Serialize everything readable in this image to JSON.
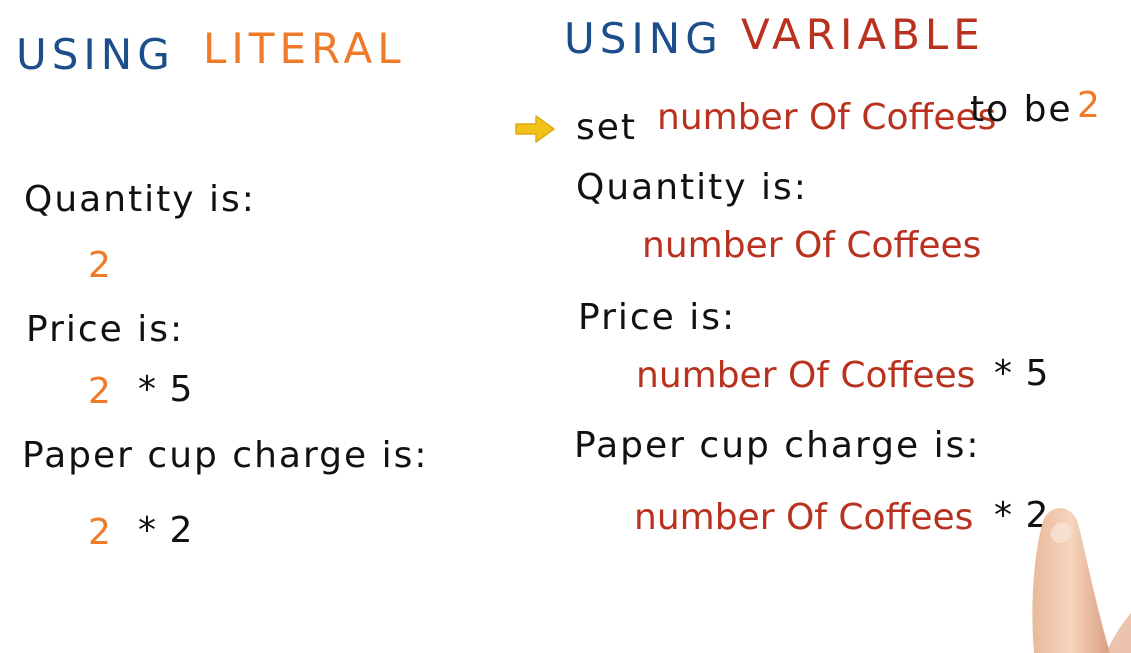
{
  "left": {
    "heading_using": "USING",
    "heading_type": "LITERAL",
    "quantity_label": "Quantity is:",
    "quantity_value": "2",
    "price_label": "Price is:",
    "price_number": "2",
    "price_rest": "* 5",
    "cup_label": "Paper cup charge is:",
    "cup_number": "2",
    "cup_rest": "* 2"
  },
  "right": {
    "heading_using": "USING",
    "heading_type": "VARIABLE",
    "set_prefix": "set",
    "set_variable": "number Of Coffees",
    "set_middle": "to be",
    "set_value": "2",
    "quantity_label": "Quantity is:",
    "quantity_variable": "number Of Coffees",
    "price_label": "Price is:",
    "price_variable": "number Of Coffees",
    "price_rest": "* 5",
    "cup_label": "Paper cup charge is:",
    "cup_variable": "number Of Coffees",
    "cup_rest": "* 2"
  },
  "colors": {
    "heading_blue": "#1c4e8c",
    "literal_orange": "#ee7a2a",
    "variable_red": "#b8321f",
    "ink_black": "#111111",
    "arrow_yellow": "#f2c21b"
  },
  "icons": {
    "pointer_arrow": "arrow-right-icon",
    "hand": "finger-pointer-icon"
  }
}
